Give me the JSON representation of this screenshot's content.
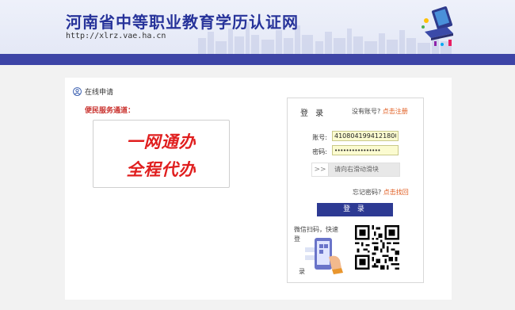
{
  "header": {
    "title": "河南省中等职业教育学历认证网",
    "url": "http://xlrz.vae.ha.cn",
    "brand_color": "#27339a",
    "nav_color": "#3d44a6"
  },
  "sidebar": {
    "online_apply": "在线申请",
    "service_label": "便民服务通道：",
    "slogan_line1": "一网通办",
    "slogan_line2": "全程代办",
    "slogan_color": "#e01e1e"
  },
  "login": {
    "title": "登 录",
    "no_account": "没有账号?",
    "register_link": "点击注册",
    "account_label": "账号:",
    "account_value": "410804199412180068",
    "password_label": "密码:",
    "password_value": "••••••••••••••••",
    "slider_handle": ">>",
    "slider_text": "请向右滑动滑块",
    "forgot": "忘记密码?",
    "forgot_link": "点击找回",
    "button": "登 录",
    "wechat_text": "微信扫码，快速登",
    "wechat_tail": "录",
    "button_color": "#2d3a93",
    "link_color": "#e05a1c"
  },
  "icons": {
    "user": "user-icon",
    "qr": "qr-code-icon",
    "phone": "phone-scan-icon",
    "header_art": "computer-illustration-icon"
  }
}
